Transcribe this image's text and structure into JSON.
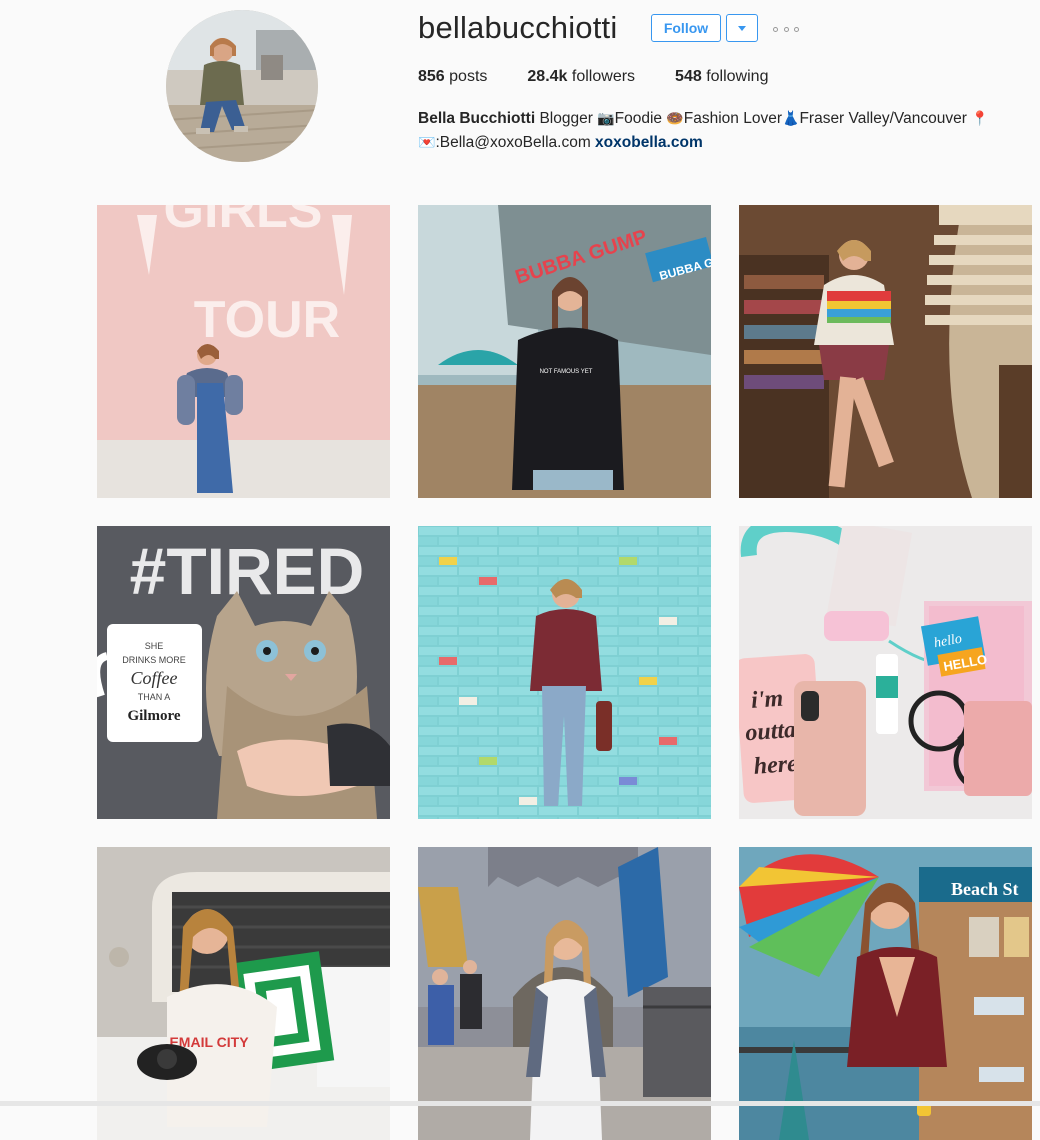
{
  "profile": {
    "username": "bellabucchiotti",
    "follow_label": "Follow",
    "stats": {
      "posts_count": "856",
      "posts_label": "posts",
      "followers_count": "28.4k",
      "followers_label": "followers",
      "following_count": "548",
      "following_label": "following"
    },
    "bio": {
      "full_name": "Bella Bucchiotti",
      "segment_1": " Blogger ",
      "segment_2": "Foodie ",
      "segment_3": "Fashion Lover",
      "segment_4": "Fraser Valley/Vancouver ",
      "email_prefix": ":Bella@xoxoBella.com ",
      "website": "xoxobella.com"
    }
  },
  "icons": {
    "camera": "📷",
    "donut": "🍩",
    "dress": "👗",
    "pin": "📍",
    "letter": "💌"
  },
  "colors": {
    "accent": "#3897f0",
    "link": "#003569",
    "background": "#fafafa"
  },
  "posts": [
    {
      "alt": "girl in denim dress against pink wall",
      "sign_text_1": "GIRLS",
      "sign_text_2": "TOUR"
    },
    {
      "alt": "girl in black sweatshirt on boardwalk",
      "sign_text_1": "BUBBA GUMP",
      "sign_text_2": "BUBBA GU",
      "shirt_text": "NOT FAMOUS YET"
    },
    {
      "alt": "girl in colorful sweater at bookstore"
    },
    {
      "alt": "cat with coffee mug",
      "shirt_text": "#TIRED",
      "mug_line_1": "SHE",
      "mug_line_2": "DRINKS MORE",
      "mug_line_3": "Coffee",
      "mug_line_4": "THAN A",
      "mug_line_5": "Gilmore"
    },
    {
      "alt": "girl against blue brick wall"
    },
    {
      "alt": "flatlay with headphones and phone",
      "case_line_1": "i'm",
      "case_line_2": "outta",
      "case_line_3": "here",
      "note_line_1": "hello",
      "note_line_2": "HELLO"
    },
    {
      "alt": "girl smiling on bed",
      "shirt_text": "EMAIL CITY"
    },
    {
      "alt": "girl at castle"
    },
    {
      "alt": "girl at pier with umbrella",
      "sign_text_1": "Beach St"
    }
  ]
}
